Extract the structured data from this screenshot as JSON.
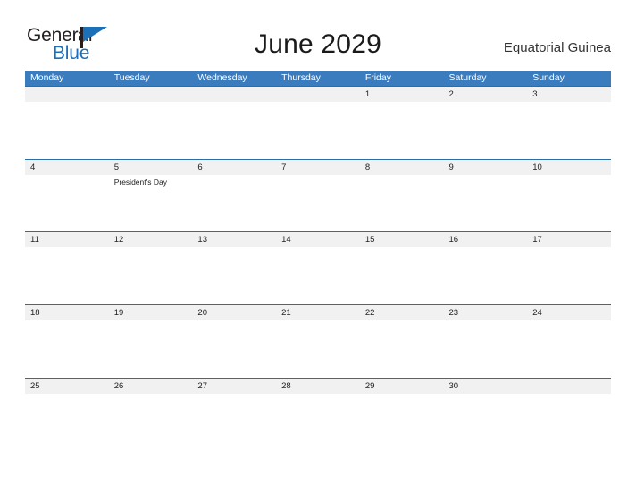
{
  "brand": {
    "line1": "General",
    "line2": "Blue",
    "flag_icon": "flag-triangle-icon",
    "accent_color": "#1c70b8"
  },
  "header": {
    "title": "June 2029",
    "locale": "Equatorial Guinea"
  },
  "theme": {
    "header_blue": "#3b7cbe",
    "row_divider": "#2e6da4",
    "date_band_gray": "#f1f1f1",
    "text_dark": "#222222"
  },
  "calendar": {
    "weekdays": [
      "Monday",
      "Tuesday",
      "Wednesday",
      "Thursday",
      "Friday",
      "Saturday",
      "Sunday"
    ],
    "weeks": [
      {
        "days": [
          {
            "date": "",
            "events": []
          },
          {
            "date": "",
            "events": []
          },
          {
            "date": "",
            "events": []
          },
          {
            "date": "",
            "events": []
          },
          {
            "date": "1",
            "events": []
          },
          {
            "date": "2",
            "events": []
          },
          {
            "date": "3",
            "events": []
          }
        ]
      },
      {
        "days": [
          {
            "date": "4",
            "events": []
          },
          {
            "date": "5",
            "events": [
              "President's Day"
            ]
          },
          {
            "date": "6",
            "events": []
          },
          {
            "date": "7",
            "events": []
          },
          {
            "date": "8",
            "events": []
          },
          {
            "date": "9",
            "events": []
          },
          {
            "date": "10",
            "events": []
          }
        ]
      },
      {
        "days": [
          {
            "date": "11",
            "events": []
          },
          {
            "date": "12",
            "events": []
          },
          {
            "date": "13",
            "events": []
          },
          {
            "date": "14",
            "events": []
          },
          {
            "date": "15",
            "events": []
          },
          {
            "date": "16",
            "events": []
          },
          {
            "date": "17",
            "events": []
          }
        ]
      },
      {
        "days": [
          {
            "date": "18",
            "events": []
          },
          {
            "date": "19",
            "events": []
          },
          {
            "date": "20",
            "events": []
          },
          {
            "date": "21",
            "events": []
          },
          {
            "date": "22",
            "events": []
          },
          {
            "date": "23",
            "events": []
          },
          {
            "date": "24",
            "events": []
          }
        ]
      },
      {
        "days": [
          {
            "date": "25",
            "events": []
          },
          {
            "date": "26",
            "events": []
          },
          {
            "date": "27",
            "events": []
          },
          {
            "date": "28",
            "events": []
          },
          {
            "date": "29",
            "events": []
          },
          {
            "date": "30",
            "events": []
          },
          {
            "date": "",
            "events": []
          }
        ]
      }
    ]
  }
}
